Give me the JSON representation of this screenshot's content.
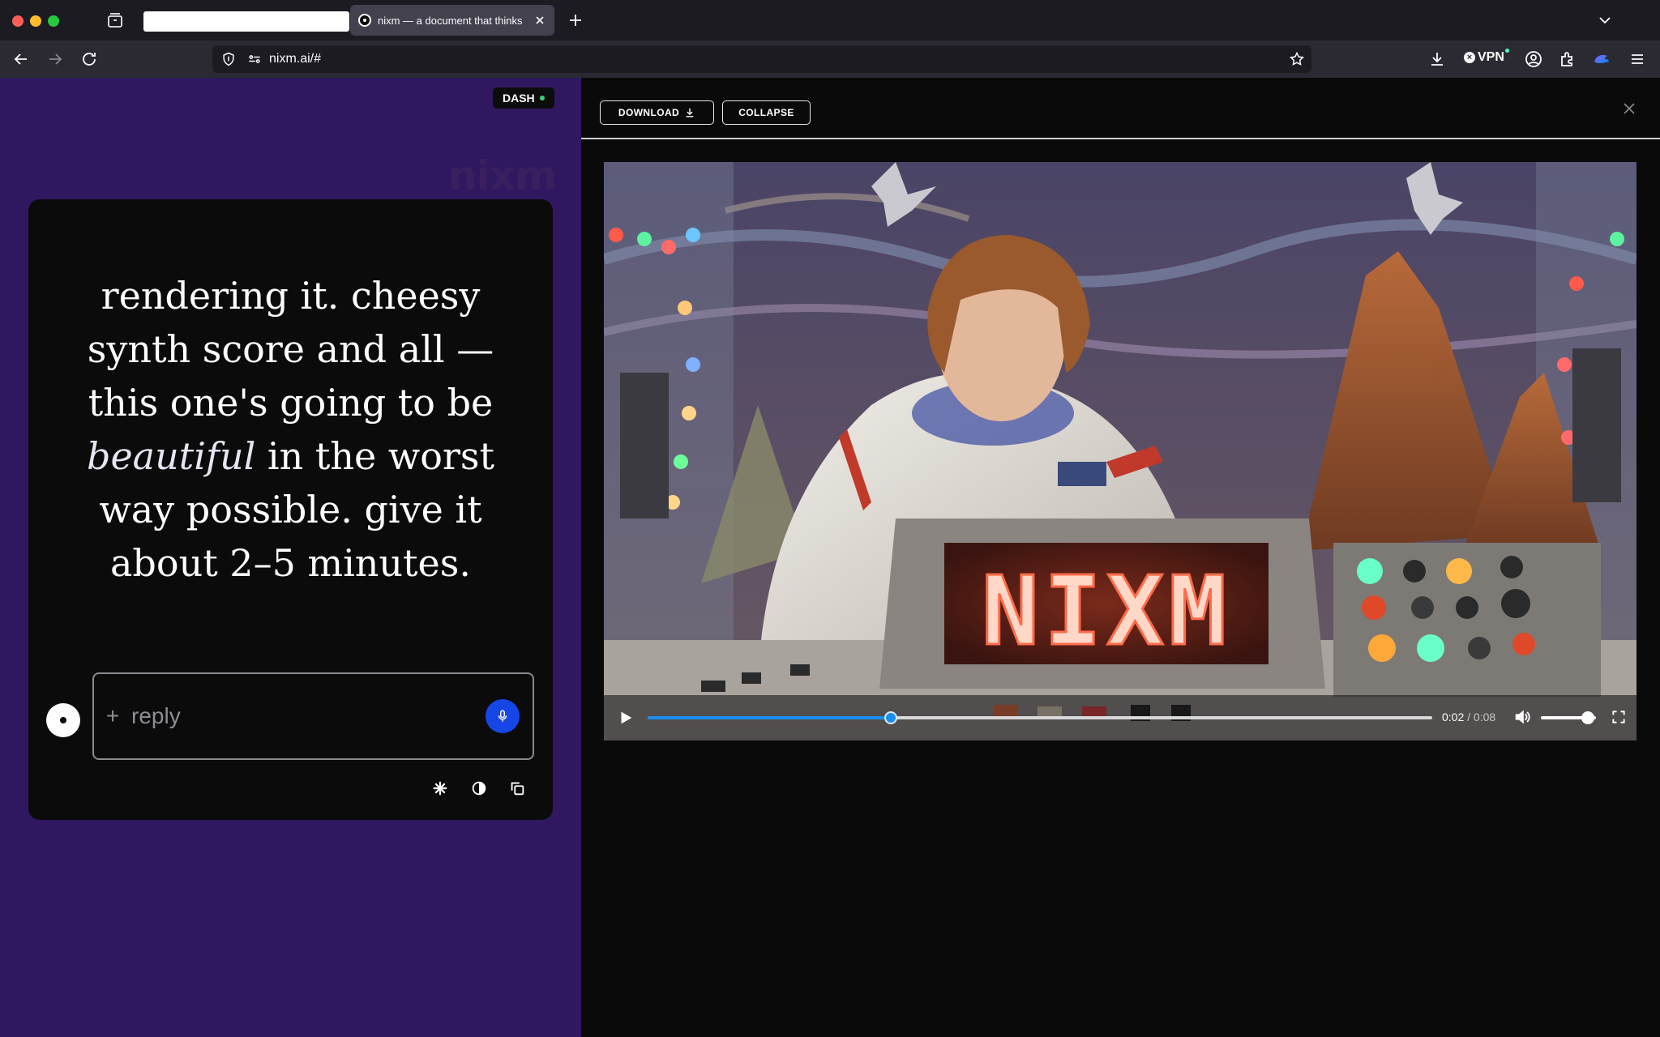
{
  "browser": {
    "tab_title": "nixm — a document that thinks",
    "url": "nixm.ai/#",
    "vpn_label": "VPN"
  },
  "left": {
    "dash_label": "DASH",
    "brand": "nixm",
    "message": {
      "part1": "rendering it. cheesy synth score and all — this one's going to be",
      "emphasis": "beautiful",
      "part2": "in the worst way possible. give it about 2–5 minutes."
    },
    "reply_placeholder": "reply"
  },
  "viewer": {
    "download_label": "DOWNLOAD",
    "collapse_label": "COLLAPSE",
    "video": {
      "display_text": "NIXM",
      "current_time": "0:02",
      "separator": "/",
      "duration": "0:08",
      "progress_fraction": 0.31,
      "volume_fraction": 0.85
    }
  },
  "colors": {
    "left_bg": "#2f1860",
    "accent_blue": "#1a8df0",
    "mic_blue": "#1746e6"
  }
}
